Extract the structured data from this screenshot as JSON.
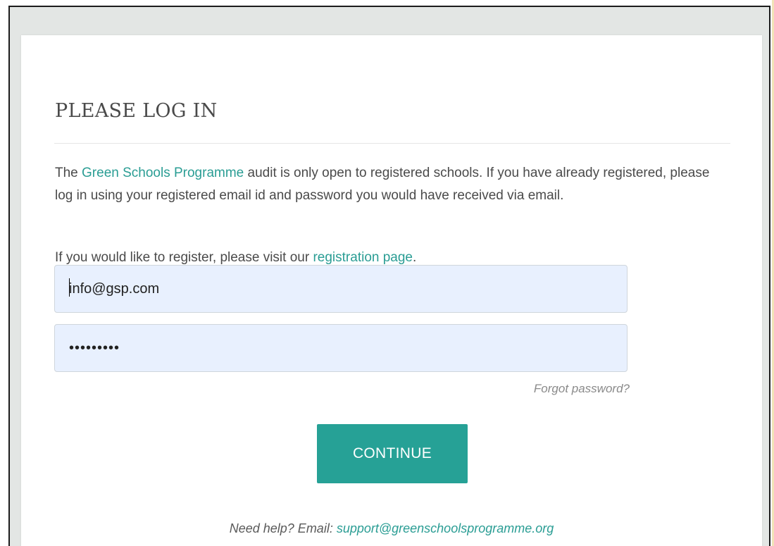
{
  "login": {
    "title": "PLEASE LOG IN",
    "intro": {
      "prefix": "The ",
      "program_link": "Green Schools Programme",
      "suffix": " audit is only open to registered schools. If you have already registered, please log in using your registered email id and password you would have received via email."
    },
    "register": {
      "prefix": "If you would like to register, please visit our ",
      "link": "registration page",
      "suffix": "."
    },
    "email_value": "info@gsp.com",
    "password_value": "•••••••••",
    "forgot_label": "Forgot password?",
    "continue_label": "CONTINUE",
    "help": {
      "prefix": "Need help? Email: ",
      "email": "support@greenschoolsprogramme.org"
    }
  },
  "colors": {
    "accent": "#26a196",
    "link": "#2a9d94",
    "field_bg": "#e8f0fe",
    "page_bg": "#e3e6e4"
  }
}
